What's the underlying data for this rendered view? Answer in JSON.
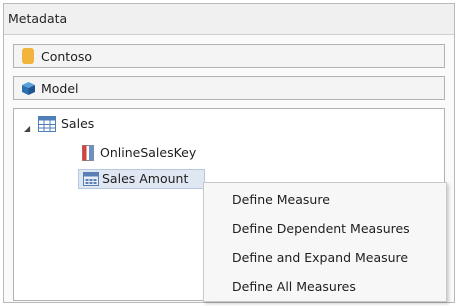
{
  "panel": {
    "title": "Metadata"
  },
  "database_selector": {
    "value": "Contoso",
    "icon": "database-icon"
  },
  "model_selector": {
    "value": "Model",
    "icon": "cube-icon"
  },
  "tree": {
    "root": {
      "label": "Sales",
      "icon": "table-icon",
      "expanded": true
    },
    "children": [
      {
        "label": "OnlineSalesKey",
        "icon": "column-icon"
      },
      {
        "label": "Sales Amount",
        "icon": "measure-icon",
        "selected": true
      }
    ]
  },
  "context_menu": {
    "items": [
      "Define Measure",
      "Define Dependent Measures",
      "Define and Expand Measure",
      "Define All Measures"
    ]
  },
  "colors": {
    "selection_bg": "#dfe7f2",
    "database_icon": "#f2b43d",
    "cube_icon": "#2a6fb0",
    "key_icon": "#d9413a"
  }
}
